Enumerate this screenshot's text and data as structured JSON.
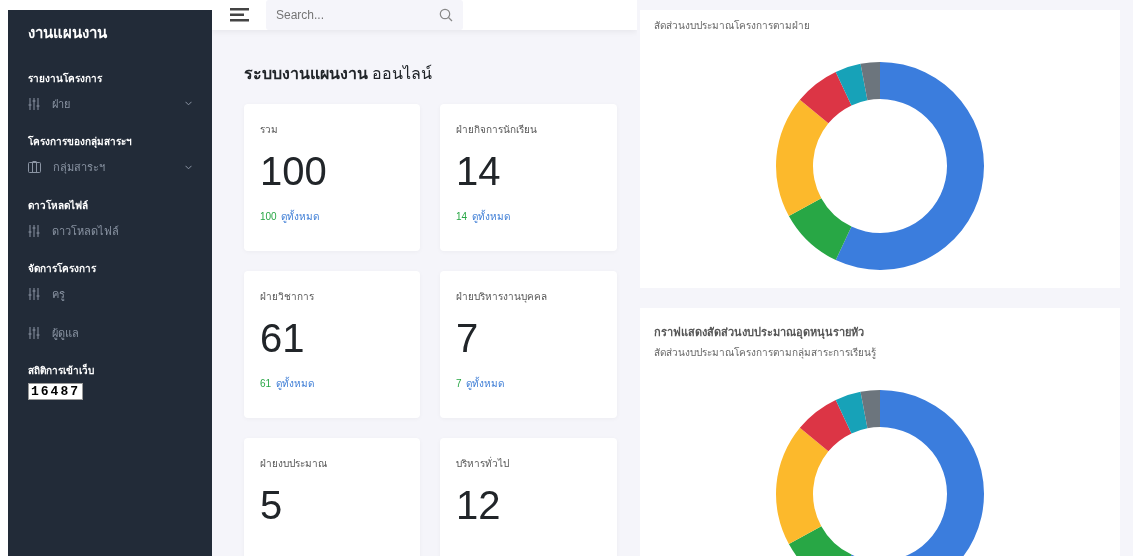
{
  "sidebar": {
    "title": "งานแผนงาน",
    "sections": [
      {
        "heading": "รายงานโครงการ",
        "items": [
          {
            "label": "ฝ่าย",
            "kind": "sliders",
            "expandable": true
          }
        ]
      },
      {
        "heading": "โครงการของกลุ่มสาระฯ",
        "items": [
          {
            "label": "กลุ่มสาระฯ",
            "kind": "columns",
            "expandable": true
          }
        ]
      },
      {
        "heading": "ดาวโหลดไฟล์",
        "items": [
          {
            "label": "ดาวโหลดไฟล์",
            "kind": "sliders",
            "expandable": false
          }
        ]
      },
      {
        "heading": "จัดการโครงการ",
        "items": [
          {
            "label": "ครู",
            "kind": "sliders",
            "expandable": false
          },
          {
            "label": "ผู้ดูแล",
            "kind": "sliders",
            "expandable": false
          }
        ]
      }
    ],
    "counter": {
      "label": "สถิติการเข้าเว็บ",
      "value": "16487"
    }
  },
  "header": {
    "search": {
      "placeholder": "Search..."
    }
  },
  "page_title": "**ระบบงานแผนงาน** ออนไลน์",
  "cards": [
    {
      "title": "รวม",
      "value": "100",
      "count": "100",
      "link": "ดูทั้งหมด"
    },
    {
      "title": "ฝ่ายกิจการนักเรียน",
      "value": "14",
      "count": "14",
      "link": "ดูทั้งหมด"
    },
    {
      "title": "ฝ่ายวิชาการ",
      "value": "61",
      "count": "61",
      "link": "ดูทั้งหมด"
    },
    {
      "title": "ฝ่ายบริหารงานบุคคล",
      "value": "7",
      "count": "7",
      "link": "ดูทั้งหมด"
    },
    {
      "title": "ฝ่ายงบประมาณ",
      "value": "5"
    },
    {
      "title": "บริหารทั่วไป",
      "value": "12"
    }
  ],
  "charts": [
    {
      "title": "สัดส่วนงบประมาณโครงการตามฝ่าย"
    },
    {
      "heading": "กราฟแสดงสัดส่วนงบประมาณอุดหนุนรายหัว",
      "title": "สัดส่วนงบประมาณโครงการตามกลุ่มสาระการเรียนรู้"
    }
  ]
}
